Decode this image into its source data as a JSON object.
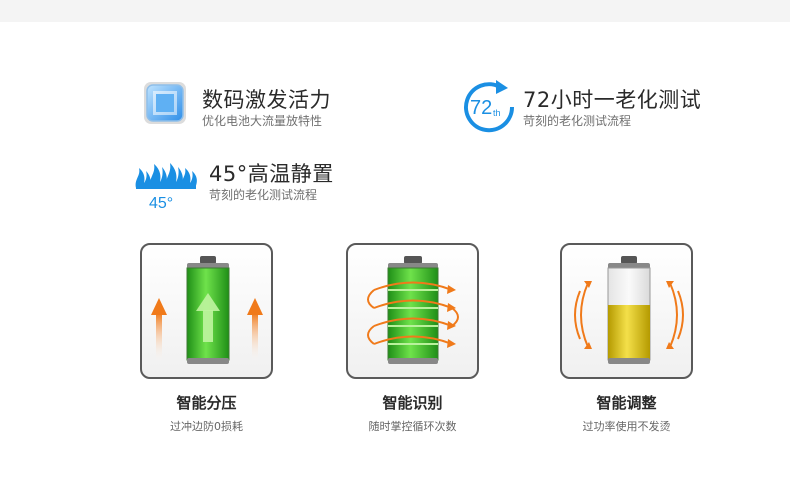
{
  "features": [
    {
      "title": "数码激发活力",
      "subtitle": "优化电池大流量放特性",
      "icon": "chip-icon"
    },
    {
      "title": "72小时一老化测试",
      "subtitle": "苛刻的老化测试流程",
      "icon": "72h-cycle-icon",
      "icon_text": "72",
      "icon_sup": "th"
    },
    {
      "title": "45°高温静置",
      "subtitle": "苛刻的老化测试流程",
      "icon": "flame-icon",
      "icon_text": "45°"
    }
  ],
  "cards": [
    {
      "title": "智能分压",
      "subtitle": "过冲边防0损耗",
      "icon": "battery-up-arrows-icon",
      "fill_level": 1.0
    },
    {
      "title": "智能识别",
      "subtitle": "随时掌控循环次数",
      "icon": "battery-cycle-icon",
      "fill_level": 1.0
    },
    {
      "title": "智能调整",
      "subtitle": "过功率使用不发烫",
      "icon": "battery-half-icon",
      "fill_level": 0.6
    }
  ],
  "colors": {
    "blue": "#1a8fe3",
    "green": "#3bbf2a",
    "orange": "#f07a1a",
    "yellow": "#e6c619"
  }
}
